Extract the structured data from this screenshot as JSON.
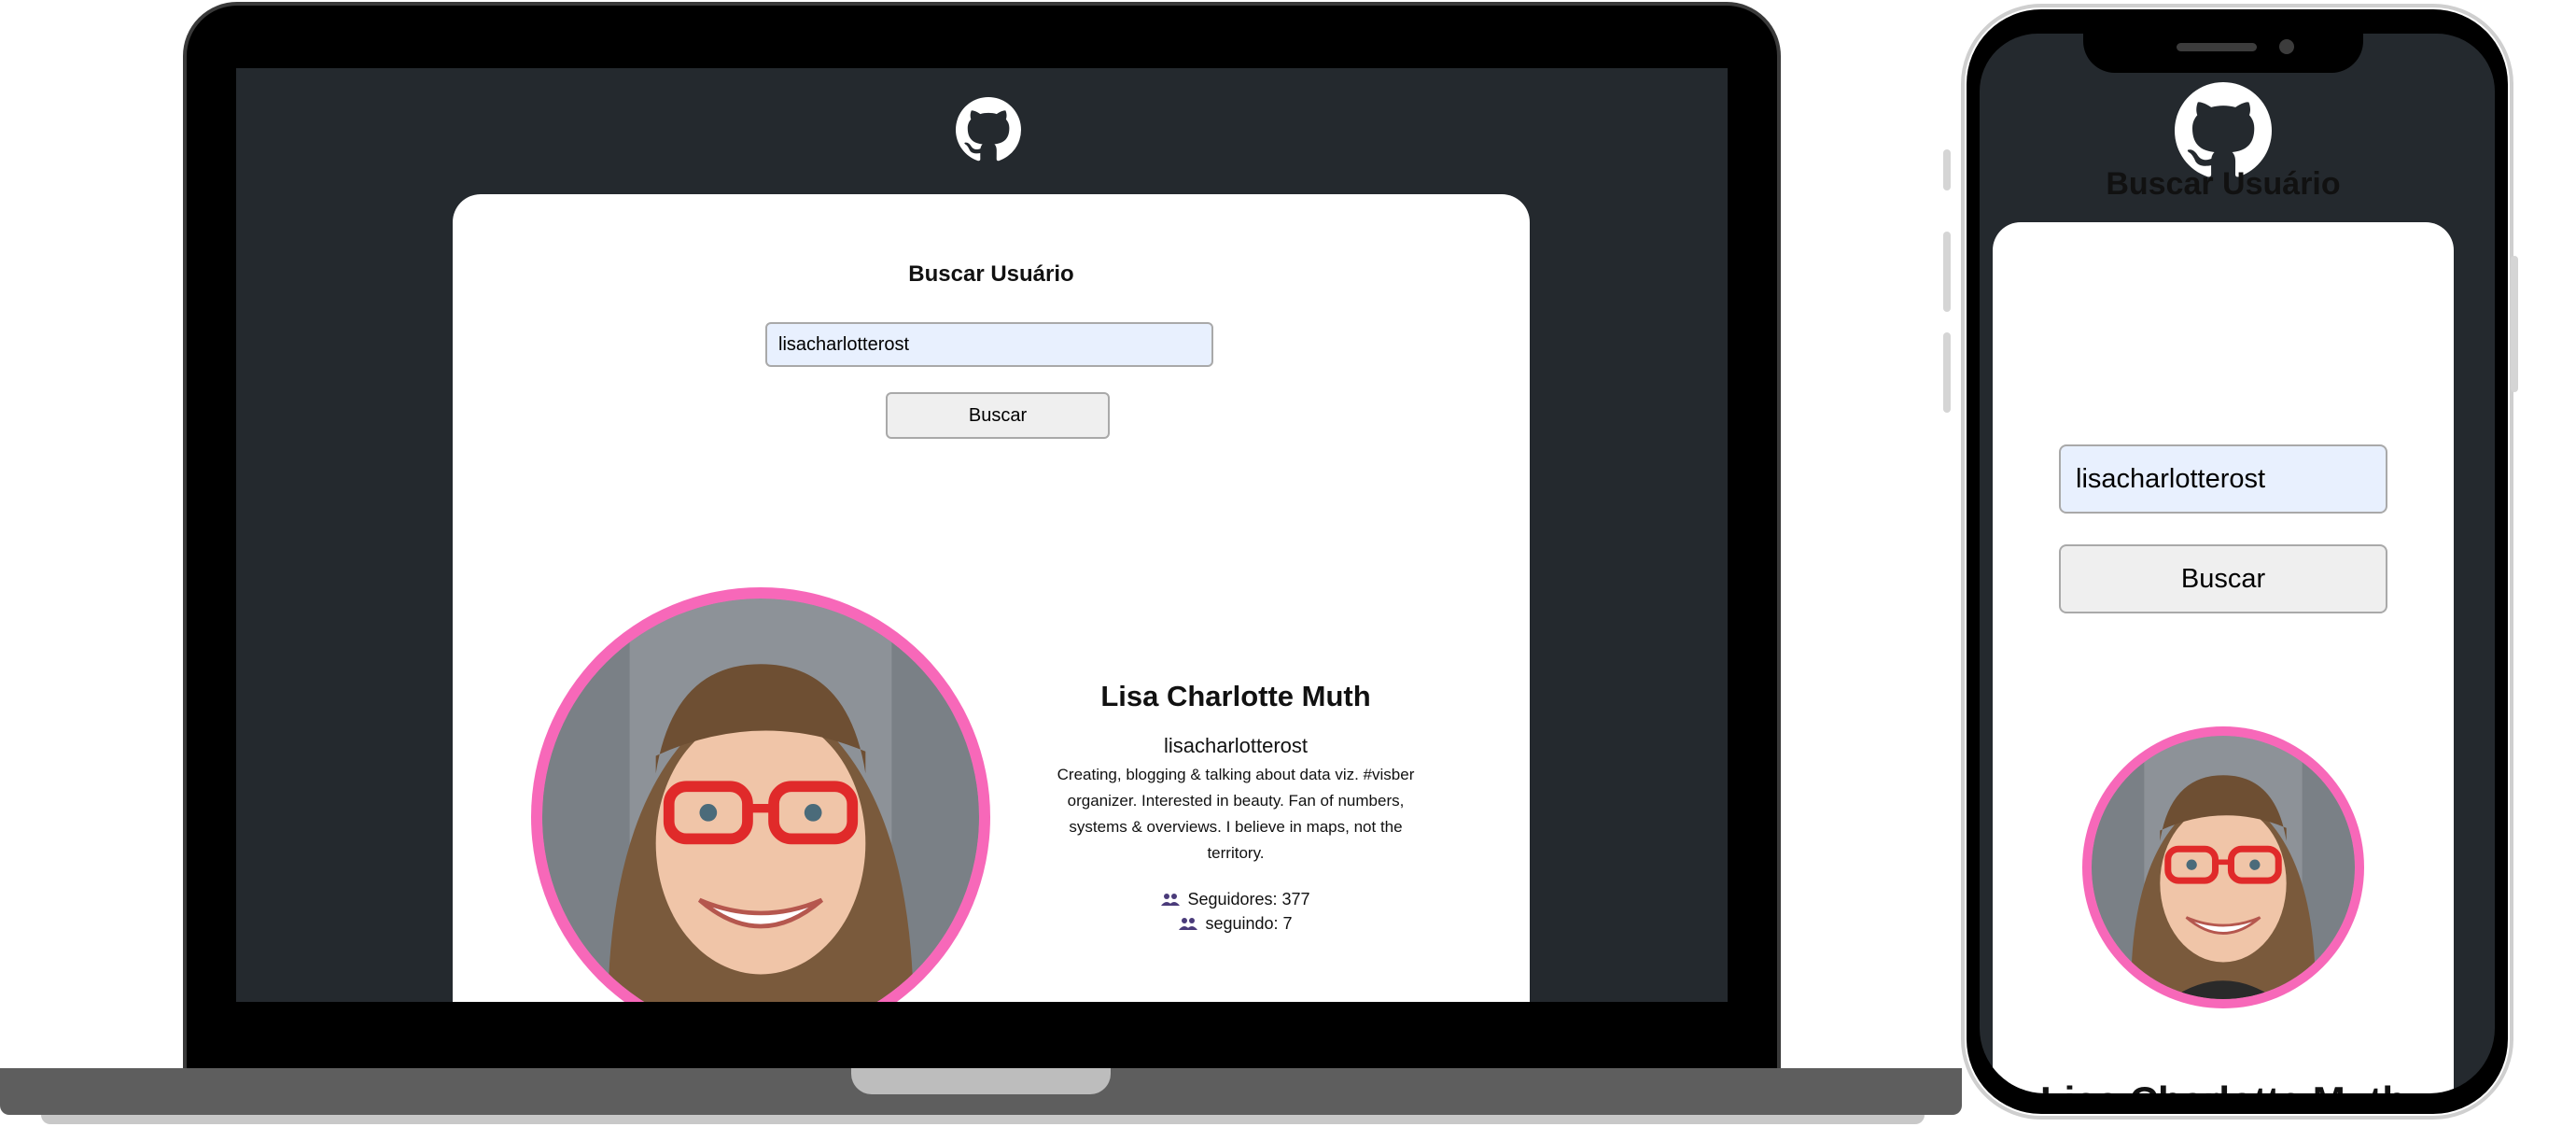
{
  "search": {
    "title": "Buscar Usuário",
    "input_value": "lisacharlotterost",
    "button_label": "Buscar"
  },
  "profile": {
    "name": "Lisa Charlotte Muth",
    "login": "lisacharlotterost",
    "bio": "Creating, blogging & talking about data viz. #visber organizer. Interested in beauty. Fan of numbers, systems & overviews. I believe in maps, not the territory.",
    "followers_label": "Seguidores: 377",
    "following_label": "seguindo: 7"
  },
  "icons": {
    "logo": "github-logo-icon",
    "followers": "people-icon"
  },
  "colors": {
    "page_background": "#24292e",
    "avatar_ring": "#f768b9",
    "input_background": "#e8f0fe",
    "button_background": "#efefef"
  }
}
